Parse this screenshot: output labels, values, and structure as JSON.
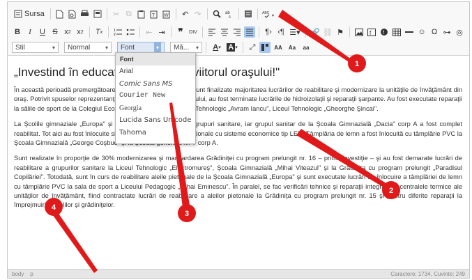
{
  "toolbar": {
    "source_label": "Sursa",
    "style_combo": "Stil",
    "format_combo": "Normal",
    "font_combo": "Font",
    "size_combo": "Mă...",
    "size_a1": "AA",
    "size_a2": "Aa",
    "size_a3": "aa"
  },
  "font_dropdown": {
    "header": "Font",
    "options": [
      "Arial",
      "Comic Sans MS",
      "Courier New",
      "Georgia",
      "Lucida Sans Unicode",
      "Tahoma"
    ]
  },
  "content": {
    "title": "„Investind în educaţie, investim în viitorul oraşului!\"",
    "paragraphs": [
      "În această perioadă premergătoare începerii noului an şcolar, sunt finalizate majoritatea lucrărilor de reabilitare şi modernizare la unităţile de învăţământ din oraş. Potrivit spuse­lor reprezentanţilor Direcţiei Şcoli a Municipiului, au fost terminate lucrările de hidroizolaţii şi reparaţii şarpante. Au fost executate reparaţii la sălile de sport de la Colegiul Economic „Transilvania\", Liceul Tehnologic „Avram Iancu\", Liceul Tehnologic „Gheorghe Şincai\".",
      "La Şcolile gimnaziale „Europa\" şi „Deşa\" au fost amenajate grupuri sanitare, iar grupul sanitar de la Şcoala Gimnazială „Dacia\" corp A a fost complet reabilitat. Tot aici au fost înlocuite sistemele de iluminat convenţionale cu sisteme economice tip LED. Tâmplăria de lemn a fost înlocuită cu tâmplărie PVC la Şcoala Gimnazială „George Coşbuc\" şi la Şcoala generală nr. 7 corp A.",
      "Sunt realizate în proporţie de 30% modernizarea şi mansardarea Grădiniţei cu program prelungit nr. 16 – prima investiţie – şi au fost demarate lucrări de reabilitare a grupurilor sanitare la Liceul Tehnologic „Electromureş\", Şcoala Gimnazială „Mihai Viteazul\" şi la Grădiniţa cu program prelungit „Paradisul Copilăriei\". Totodată, sunt în curs de reabilitare aleile pietonale de la Şcoala Gimnazială „Europa\" şi sunt executate lucrări de înlocuire a tâmplăriei de lemn cu tâmplărie PVC la sala de sport a Liceului Pedagogic „Mihai Eminescu\". În paralel, se fac verificări tehnice şi reparaţii integrale la centralele termice ale unităţilor de învăţământ, fiind contractate lucrări de reabilitare a aleilor pietonale la Grădiniţa cu program prelungit nr. 15 şi pentru diferite reparaţii la împrejmuirile şcolilor şi grădiniţelor."
    ]
  },
  "statusbar": {
    "path_body": "body",
    "path_p": "p",
    "counts": "Caractere: 1734, Cuvinte: 249"
  },
  "annotations": {
    "color": "#e01a1a",
    "labels": [
      "1",
      "2",
      "3",
      "4"
    ]
  }
}
